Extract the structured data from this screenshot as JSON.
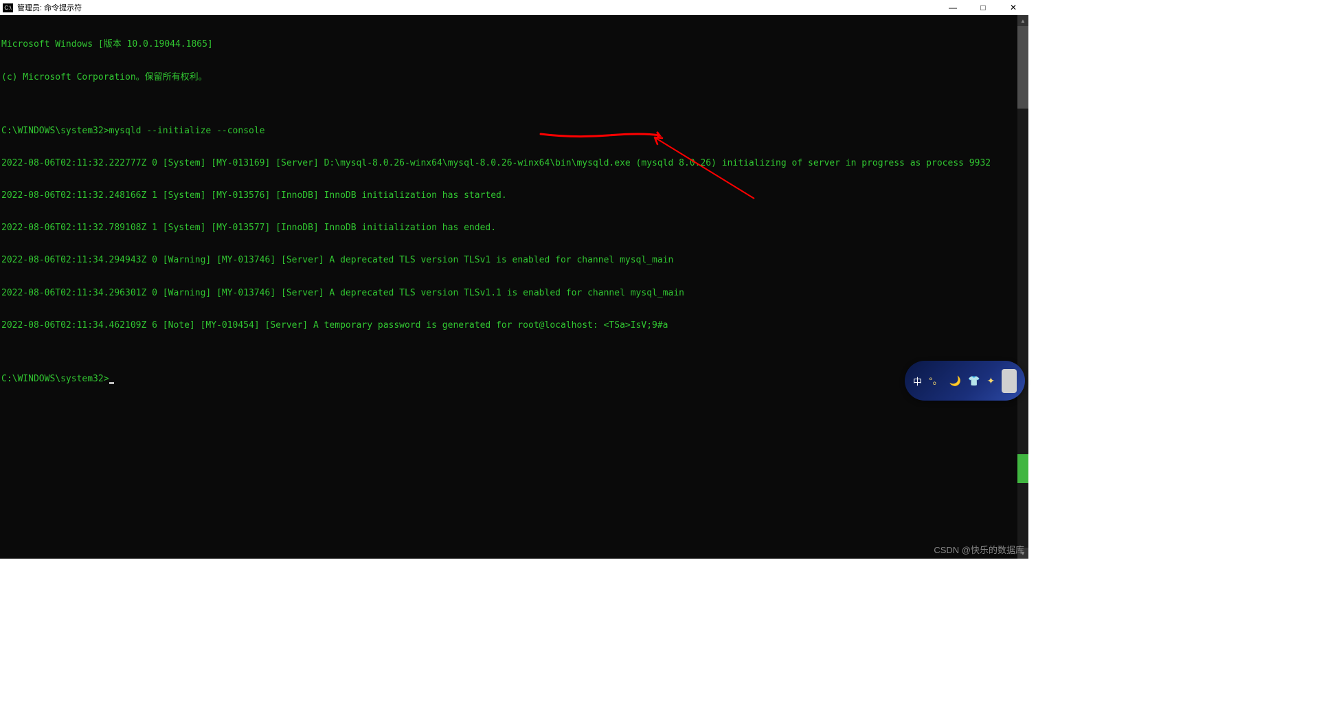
{
  "window": {
    "icon_label": "C:\\",
    "title": "管理员: 命令提示符",
    "minimize": "—",
    "maximize": "□",
    "close": "✕"
  },
  "terminal": {
    "lines": [
      "Microsoft Windows [版本 10.0.19044.1865]",
      "(c) Microsoft Corporation。保留所有权利。",
      "",
      "C:\\WINDOWS\\system32>mysqld --initialize --console",
      "2022-08-06T02:11:32.222777Z 0 [System] [MY-013169] [Server] D:\\mysql-8.0.26-winx64\\mysql-8.0.26-winx64\\bin\\mysqld.exe (mysqld 8.0.26) initializing of server in progress as process 9932",
      "2022-08-06T02:11:32.248166Z 1 [System] [MY-013576] [InnoDB] InnoDB initialization has started.",
      "2022-08-06T02:11:32.789108Z 1 [System] [MY-013577] [InnoDB] InnoDB initialization has ended.",
      "2022-08-06T02:11:34.294943Z 0 [Warning] [MY-013746] [Server] A deprecated TLS version TLSv1 is enabled for channel mysql_main",
      "2022-08-06T02:11:34.296301Z 0 [Warning] [MY-013746] [Server] A deprecated TLS version TLSv1.1 is enabled for channel mysql_main",
      "2022-08-06T02:11:34.462109Z 6 [Note] [MY-010454] [Server] A temporary password is generated for root@localhost: <TSa>IsV;9#a",
      ""
    ],
    "prompt": "C:\\WINDOWS\\system32>"
  },
  "ime": {
    "mode": "中",
    "punct": "°。",
    "moon": "🌙",
    "shirt": "👕",
    "star": "✦"
  },
  "watermark": "CSDN @快乐的数据库",
  "colors": {
    "term_fg": "#31c631",
    "term_bg": "#0a0a0a",
    "annotation": "#ff0000"
  }
}
